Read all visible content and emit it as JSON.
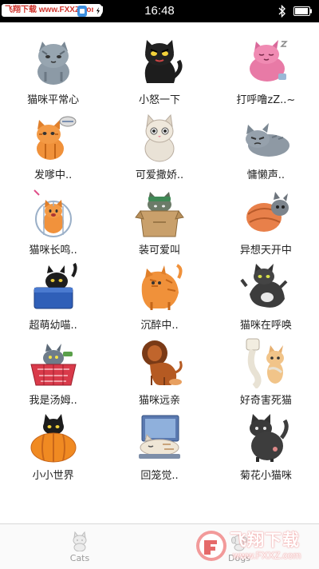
{
  "status_bar": {
    "watermark": "飞翔下载 www.FXXZ.com",
    "time": "16:48",
    "icons": [
      "app-icon",
      "shield-icon",
      "bluetooth-icon",
      "battery-icon"
    ]
  },
  "stickers": [
    {
      "label": "猫咪平常心",
      "icon": "gray-cat-sitting"
    },
    {
      "label": "小怒一下",
      "icon": "black-cat-angry"
    },
    {
      "label": "打呼噜zZ..~",
      "icon": "pink-cat-sleeping"
    },
    {
      "label": "发嗲中..",
      "icon": "orange-cat-fish"
    },
    {
      "label": "可爱撒娇..",
      "icon": "white-cat-sitting"
    },
    {
      "label": "慵懒声..",
      "icon": "gray-cat-lying"
    },
    {
      "label": "猫咪长鸣..",
      "icon": "orange-cat-cage"
    },
    {
      "label": "装可爱叫",
      "icon": "cat-in-box"
    },
    {
      "label": "异想天开中",
      "icon": "cat-curled"
    },
    {
      "label": "超萌幼喵..",
      "icon": "black-cat-in-box"
    },
    {
      "label": "沉醉中..",
      "icon": "orange-cat-standing"
    },
    {
      "label": "猫咪在呼唤",
      "icon": "dark-cat-stretch"
    },
    {
      "label": "我是汤姆..",
      "icon": "cat-in-basket"
    },
    {
      "label": "猫咪远亲",
      "icon": "lion"
    },
    {
      "label": "好奇害死猫",
      "icon": "cat-with-toilet-paper"
    },
    {
      "label": "小小世界",
      "icon": "cat-in-pumpkin"
    },
    {
      "label": "回笼觉..",
      "icon": "cat-sleeping-laptop"
    },
    {
      "label": "菊花小猫咪",
      "icon": "dark-cat-back"
    }
  ],
  "tabs": [
    {
      "label": "Cats",
      "icon": "cat-icon",
      "active": true
    },
    {
      "label": "Dogs",
      "icon": "dog-icon",
      "active": false
    }
  ],
  "watermark_br": {
    "title": "飞翔下载",
    "url": "www.FXXZ.com"
  }
}
